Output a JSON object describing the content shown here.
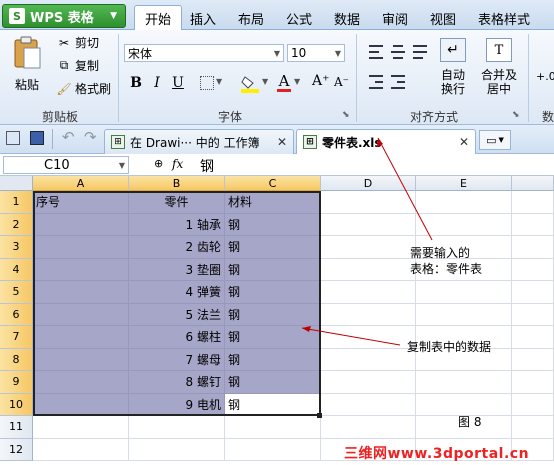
{
  "app": {
    "name": "WPS 表格"
  },
  "ribbon_tabs": [
    "开始",
    "插入",
    "布局",
    "公式",
    "数据",
    "审阅",
    "视图",
    "表格样式"
  ],
  "clipboard": {
    "paste": "粘贴",
    "cut": "剪切",
    "copy": "复制",
    "format_painter": "格式刷",
    "group": "剪贴板"
  },
  "font": {
    "name": "宋体",
    "size": "10",
    "group": "字体",
    "bold": "B",
    "italic": "I",
    "underline": "U",
    "font_color_glyph": "A",
    "grow": "A⁺",
    "shrink": "A⁻"
  },
  "alignment": {
    "wrap": "自动\n换行",
    "wrap_line1": "自动",
    "wrap_line2": "换行",
    "merge_line1": "合并及",
    "merge_line2": "居中",
    "group": "对齐方式",
    "number_glyph": "数"
  },
  "doc_tabs": [
    {
      "label": "在 Drawi··· 中的 工作簿"
    },
    {
      "label": "零件表.xls"
    }
  ],
  "formula": {
    "cell_ref": "C10",
    "fx": "fx",
    "value": "钢"
  },
  "columns": [
    "A",
    "B",
    "C",
    "D",
    "E"
  ],
  "rows": [
    "1",
    "2",
    "3",
    "4",
    "5",
    "6",
    "7",
    "8",
    "9",
    "10",
    "11",
    "12"
  ],
  "table": [
    {
      "a": "序号",
      "b": "零件",
      "c": "材料"
    },
    {
      "a": "",
      "b": "1 轴承",
      "c": "钢"
    },
    {
      "a": "",
      "b": "2 齿轮",
      "c": "钢"
    },
    {
      "a": "",
      "b": "3 垫圈",
      "c": "钢"
    },
    {
      "a": "",
      "b": "4 弹簧",
      "c": "钢"
    },
    {
      "a": "",
      "b": "5 法兰",
      "c": "钢"
    },
    {
      "a": "",
      "b": "6 螺柱",
      "c": "钢"
    },
    {
      "a": "",
      "b": "7 螺母",
      "c": "钢"
    },
    {
      "a": "",
      "b": "8 螺钉",
      "c": "钢"
    },
    {
      "a": "",
      "b": "9 电机",
      "c": "钢"
    }
  ],
  "annotations": {
    "note1_line1": "需要输入的",
    "note1_line2": "表格：零件表",
    "note2": "复制表中的数据",
    "figure": "图 8",
    "watermark": "三维网www.3dportal.cn"
  },
  "colors": {
    "selection": "#a6a6c8",
    "annotation_arrow": "#c00000",
    "app_button": "#3a9e3a"
  }
}
